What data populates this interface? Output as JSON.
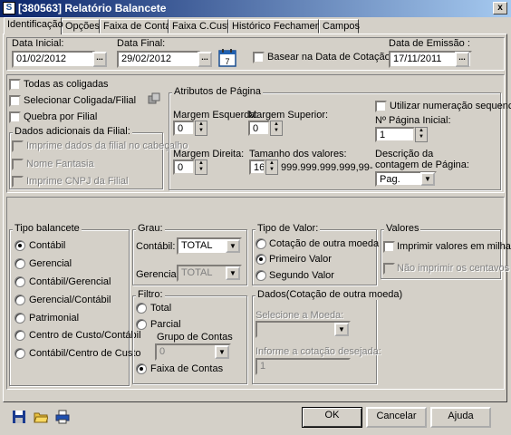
{
  "window": {
    "title": "[380563]  Relatório Balancete",
    "close": "x"
  },
  "tabs": [
    "Identificação",
    "Opções",
    "Faixa de Contas",
    "Faixa C.Custo",
    "Histórico Fechamento",
    "Campos"
  ],
  "dates": {
    "initial_label": "Data Inicial:",
    "initial_value": "01/02/2012",
    "final_label": "Data Final:",
    "final_value": "29/02/2012",
    "emission_label": "Data de Emissão :",
    "emission_value": "17/11/2011",
    "base_cotacao": "Basear na Data de Cotação",
    "calendar_day": "7"
  },
  "filial": {
    "todas": "Todas as coligadas",
    "selecionar": "Selecionar Coligada/Filial",
    "quebra": "Quebra por Filial",
    "adicionais_title": "Dados adicionais da Filial:",
    "imprime_cabecalho": "Imprime dados da filial no cabeçalho",
    "nome_fantasia": "Nome Fantasia",
    "imprime_cnpj": "Imprime CNPJ da Filial"
  },
  "atributos": {
    "title": "Atributos de Página",
    "margem_esquerda": "Margem Esquerda:",
    "margem_esquerda_val": "0",
    "margem_superior": "Margem Superior:",
    "margem_superior_val": "0",
    "margem_direita": "Margem Direita:",
    "margem_direita_val": "0",
    "tamanho": "Tamanho dos valores:",
    "tamanho_val": "16",
    "tamanho_mask": "999.999.999.999,99-",
    "numeracao": "Utilizar numeração sequencial",
    "pagina_inicial": "Nº Página Inicial:",
    "pagina_inicial_val": "1",
    "descricao_1": "Descrição da",
    "descricao_2": "contagem de Página:",
    "descricao_val": "Pag."
  },
  "tipo_balancete": {
    "title": "Tipo balancete",
    "options": [
      "Contábil",
      "Gerencial",
      "Contábil/Gerencial",
      "Gerencial/Contábil",
      "Patrimonial",
      "Centro de Custo/Contábil",
      "Contábil/Centro de Custo"
    ]
  },
  "grau": {
    "title": "Grau:",
    "contabil_label": "Contábil:",
    "contabil_val": "TOTAL",
    "gerencial_label": "Gerencial:",
    "gerencial_val": "TOTAL"
  },
  "tipo_valor": {
    "title": "Tipo de Valor:",
    "options": [
      "Cotação de outra moeda",
      "Primeiro Valor",
      "Segundo Valor"
    ]
  },
  "valores": {
    "title": "Valores",
    "imprimir_milhares": "Imprimir valores em milhares",
    "nao_centavos": "Não imprimir os centavos"
  },
  "filtro": {
    "title": "Filtro:",
    "total": "Total",
    "parcial": "Parcial",
    "grupo_label": "Grupo de Contas",
    "grupo_val": "0",
    "faixa": "Faixa de Contas"
  },
  "dados_cotacao": {
    "title": "Dados(Cotação de outra moeda)",
    "selecione_moeda": "Selecione a Moeda:",
    "informe_cotacao": "Informe a cotação desejada:",
    "cotacao_val": "1"
  },
  "footer": {
    "ok": "OK",
    "cancelar": "Cancelar",
    "ajuda": "Ajuda"
  },
  "colors": {
    "title_start": "#0a246a",
    "title_end": "#a6caf0",
    "face": "#d4d0c8"
  }
}
